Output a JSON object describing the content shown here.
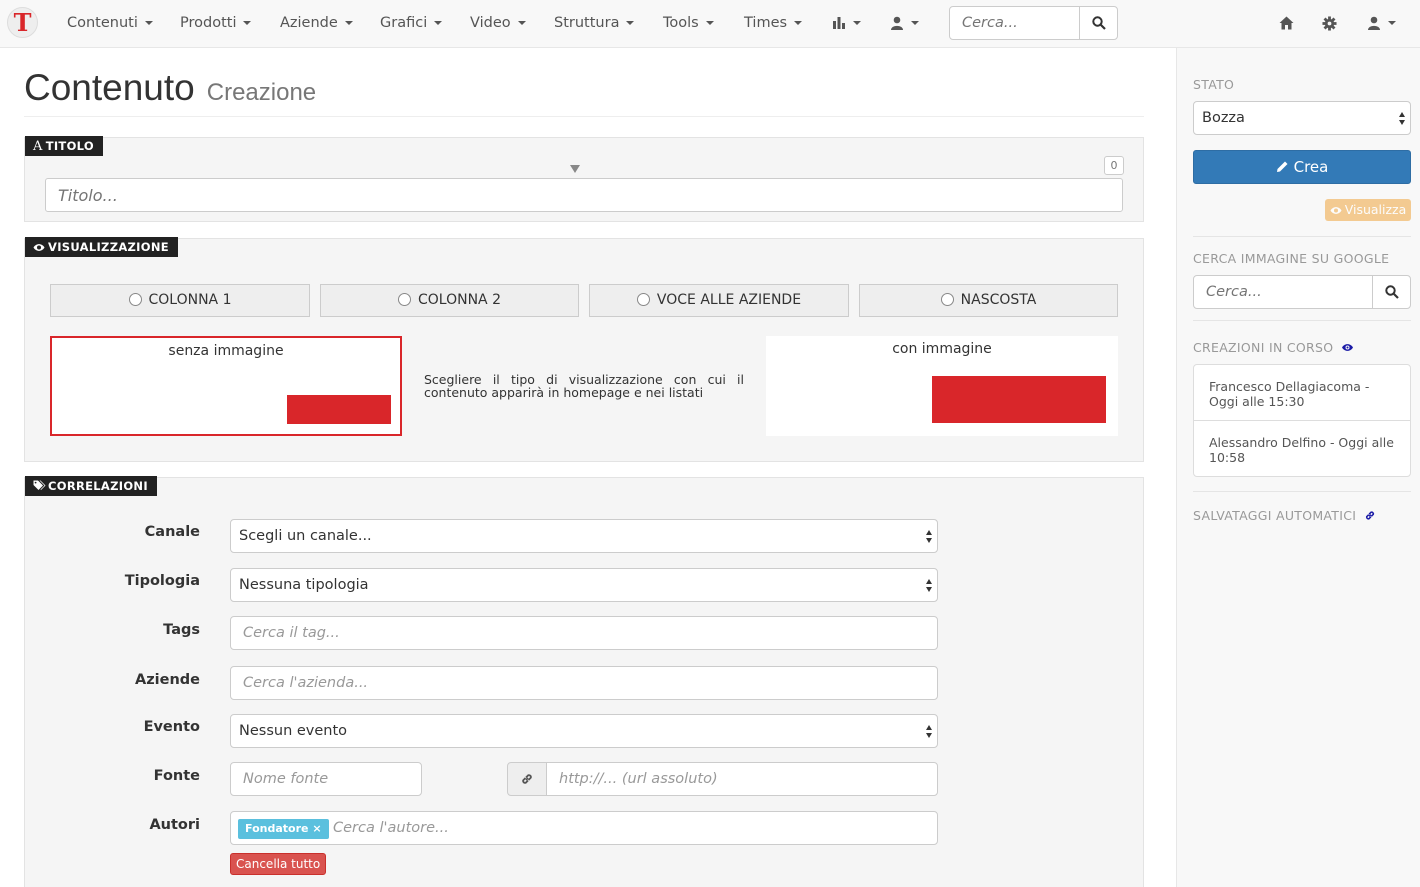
{
  "navbar": {
    "logo_letter": "T",
    "items": [
      "Contenuti",
      "Prodotti",
      "Aziende",
      "Grafici",
      "Video",
      "Struttura",
      "Tools",
      "Times"
    ],
    "search_placeholder": "Cerca..."
  },
  "page": {
    "title": "Contenuto",
    "subtitle": "Creazione"
  },
  "titolo": {
    "tag": "TITOLO",
    "tag_icon": "A",
    "counter": "0",
    "placeholder": "Titolo..."
  },
  "visualizzazione": {
    "tag": "VISUALIZZAZIONE",
    "options": [
      "COLONNA 1",
      "COLONNA 2",
      "VOCE ALLE AZIENDE",
      "NASCOSTA"
    ],
    "preview_no_image": "senza immagine",
    "preview_image": "con immagine",
    "description": "Scegliere il tipo di visualizzazione con cui il contenuto apparirà in homepage e nei listati",
    "accent_color": "#d9262a"
  },
  "correlazioni": {
    "tag": "CORRELAZIONI",
    "canale": {
      "label": "Canale",
      "value": "Scegli un canale..."
    },
    "tipologia": {
      "label": "Tipologia",
      "value": "Nessuna tipologia"
    },
    "tags": {
      "label": "Tags",
      "placeholder": "Cerca il tag..."
    },
    "aziende": {
      "label": "Aziende",
      "placeholder": "Cerca l'azienda..."
    },
    "evento": {
      "label": "Evento",
      "value": "Nessun evento"
    },
    "fonte": {
      "label": "Fonte",
      "name_placeholder": "Nome fonte",
      "url_placeholder": "http://... (url assoluto)"
    },
    "autori": {
      "label": "Autori",
      "chip": "Fondatore",
      "chip_remove": "×",
      "placeholder": "Cerca l'autore...",
      "clear": "Cancella tutto"
    }
  },
  "sidebar": {
    "stato_heading": "STATO",
    "stato_value": "Bozza",
    "crea": "Crea",
    "visualizza": "Visualizza",
    "google_heading": "CERCA IMMAGINE SU GOOGLE",
    "google_placeholder": "Cerca...",
    "creazioni_heading": "CREAZIONI IN CORSO",
    "creazioni": [
      "Francesco Dellagiacoma - Oggi alle 15:30",
      "Alessandro Delfino - Oggi alle 10:58"
    ],
    "salvataggi_heading": "SALVATAGGI AUTOMATICI",
    "primary_color": "#337ab7"
  }
}
